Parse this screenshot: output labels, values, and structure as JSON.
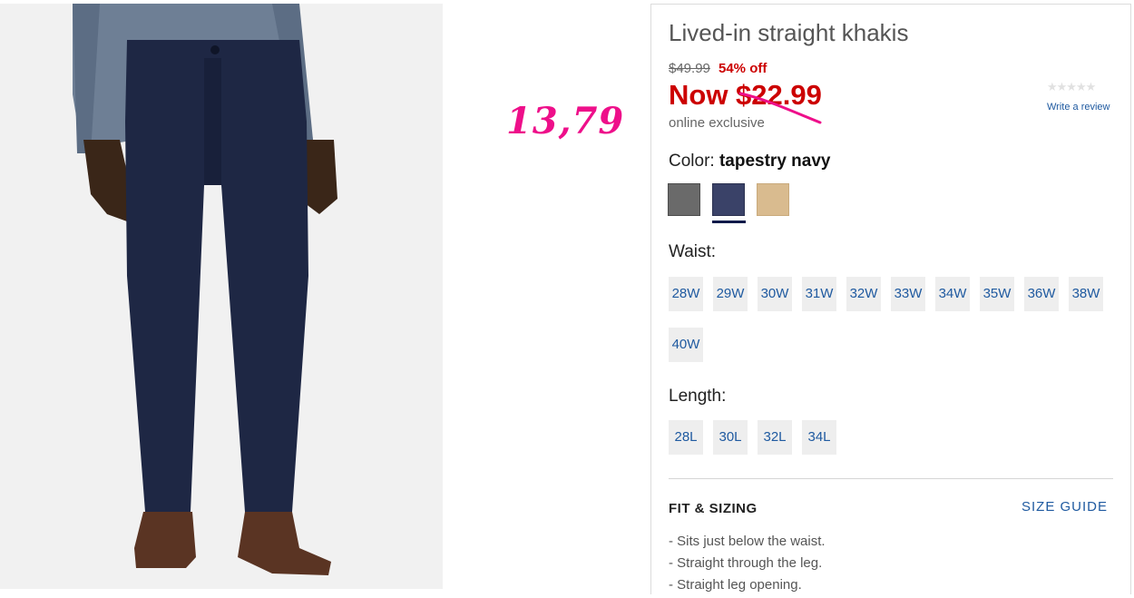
{
  "annotation": {
    "handwritten_price": "13,79"
  },
  "product": {
    "title": "Lived-in straight khakis",
    "original_price": "$49.99",
    "discount": "54% off",
    "now_price": "Now $22.99",
    "exclusive_note": "online exclusive",
    "rating": {
      "stars": "★★★★★",
      "filled": 0,
      "write_review": "Write a review"
    }
  },
  "color": {
    "label": "Color:",
    "selected": "tapestry navy",
    "swatches": [
      {
        "name": "gray",
        "hex": "#6a6a6a"
      },
      {
        "name": "tapestry navy",
        "hex": "#3a4268"
      },
      {
        "name": "khaki",
        "hex": "#d9bb8f"
      }
    ]
  },
  "waist": {
    "label": "Waist:",
    "options": [
      "28W",
      "29W",
      "30W",
      "31W",
      "32W",
      "33W",
      "34W",
      "35W",
      "36W",
      "38W",
      "40W"
    ]
  },
  "length": {
    "label": "Length:",
    "options": [
      "28L",
      "30L",
      "32L",
      "34L"
    ]
  },
  "fit": {
    "heading": "FIT & SIZING",
    "size_guide": "SIZE GUIDE",
    "bullets": [
      "- Sits just below the waist.",
      "- Straight through the leg.",
      "- Straight leg opening."
    ]
  }
}
